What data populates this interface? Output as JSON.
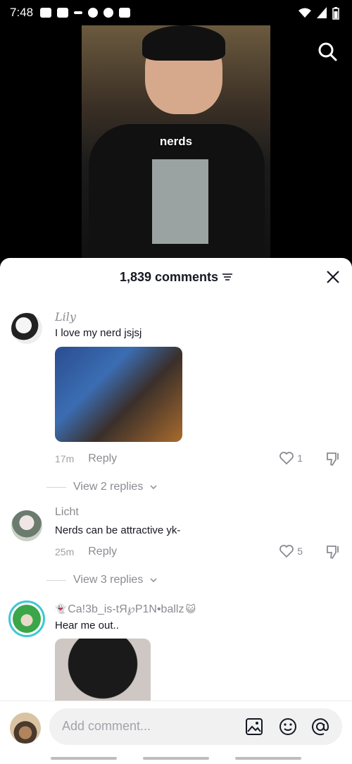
{
  "status_bar": {
    "time": "7:48"
  },
  "video": {
    "caption": "nerds"
  },
  "comments_panel": {
    "title": "1,839 comments",
    "comments": [
      {
        "name": "Lily",
        "text": "I love my nerd jsjsj",
        "time": "17m",
        "reply_label": "Reply",
        "likes": "1",
        "view_replies": "View 2 replies"
      },
      {
        "name": "Licht",
        "text": "Nerds can be attractive yk-",
        "time": "25m",
        "reply_label": "Reply",
        "likes": "5",
        "view_replies": "View 3 replies"
      },
      {
        "name": "Ca!3b_is-tЯ℘P1N•ballz",
        "text": "Hear me out.."
      }
    ]
  },
  "input": {
    "placeholder": "Add comment..."
  },
  "colors": {
    "text_primary": "#161823",
    "text_secondary": "#8a8b91",
    "accent_ring": "#3ec7d1"
  }
}
